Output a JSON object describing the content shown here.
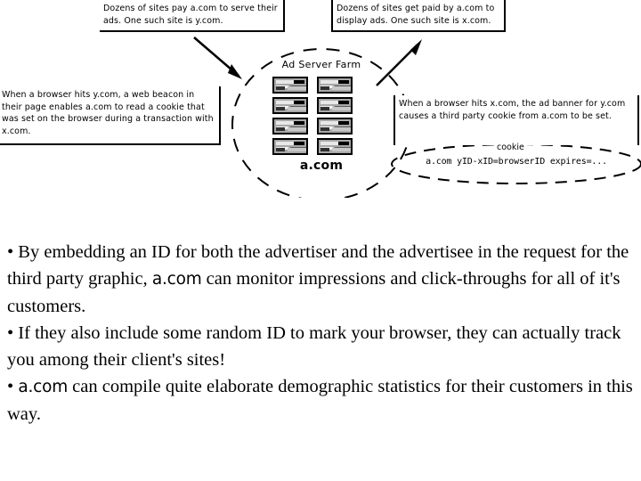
{
  "slide": {
    "background_color": "#ffffff",
    "text_color": "#000000"
  },
  "diagram": {
    "callouts": {
      "pay": "Dozens of sites pay a.com to serve their ads. One such site is y.com.",
      "paid": "Dozens of sites get paid by a.com to display ads. One such site is x.com.",
      "beacon": "When a browser hits y.com, a web beacon in their page enables a.com to read a cookie that was set on the browser during a transaction with x.com.",
      "banner": "When a browser hits x.com, the ad banner for y.com causes a third party cookie from a.com to be set."
    },
    "farm": {
      "title": "Ad Server Farm",
      "domain": "a.com",
      "server_count": 8
    },
    "cookie": {
      "label": "cookie",
      "value": "a.com  yID-xID=browserID  expires=..."
    }
  },
  "body": {
    "bullet_char": "•",
    "bullets": [
      {
        "part1": "• By embedding an ID for both the advertiser and the advertisee in the request for the third party graphic, ",
        "domain": "a.com",
        "part2": " can monitor impressions and click-throughs for all of it's customers."
      },
      {
        "part1": "• If they also include some random ID to mark your browser, they can actually track you among their client's sites!",
        "domain": "",
        "part2": ""
      },
      {
        "part1": "• ",
        "domain": "a.com",
        "part2": " can compile quite elaborate demographic statistics for their customers in this way."
      }
    ]
  }
}
